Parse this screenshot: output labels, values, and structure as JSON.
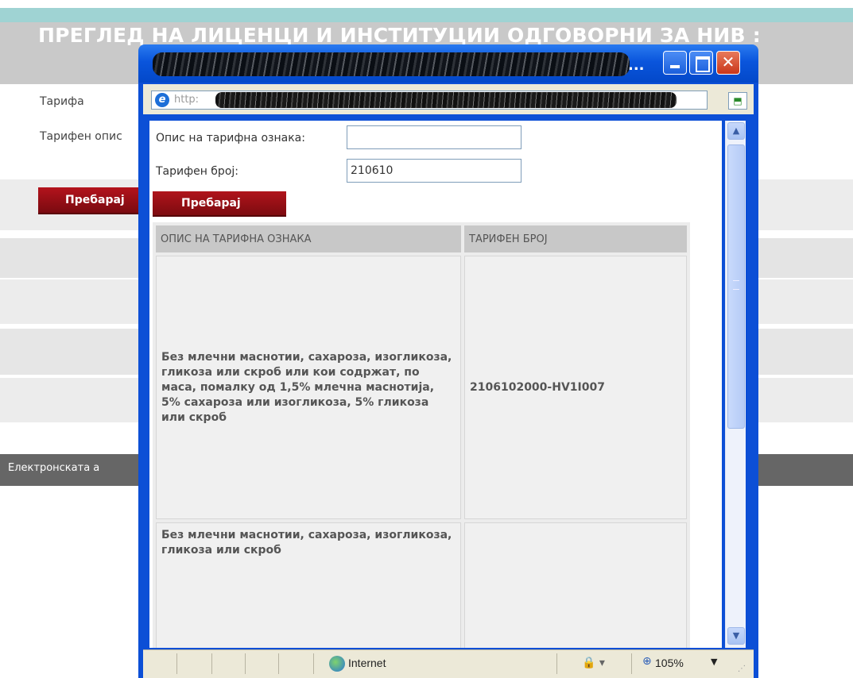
{
  "background_page": {
    "title": "ПРЕГЛЕД НА ЛИЦЕНЦИ И ИНСТИТУЦИИ ОДГОВОРНИ ЗА НИВ :",
    "label_tariff": "Тарифа",
    "label_tariff_desc": "Тарифен опис",
    "search_label": "Пребарај",
    "footer_text": "Електронската а"
  },
  "popup": {
    "title_suffix": "...",
    "address_prefix": "http:",
    "form": {
      "desc_label": "Опис на тарифна ознака:",
      "desc_value": "",
      "number_label": "Тарифен број:",
      "number_value": "210610",
      "search_label": "Пребарај"
    },
    "table": {
      "headers": [
        "ОПИС НА ТАРИФНА ОЗНАКА",
        "ТАРИФЕН БРОЈ"
      ],
      "rows": [
        {
          "desc": "Без млечни маснотии, сахароза, изогликоза, гликоза или скроб или кои содржат, по маса, помалку од 1,5% млечна маснотија, 5% сахароза или изогликоза, 5% гликоза или скроб",
          "code": "2106102000-HV1I007"
        },
        {
          "desc": "Без млечни маснотии, сахароза, изогликоза, гликоза или скроб",
          "code": ""
        }
      ]
    },
    "statusbar": {
      "zone": "Internet",
      "zoom": "105%"
    }
  }
}
